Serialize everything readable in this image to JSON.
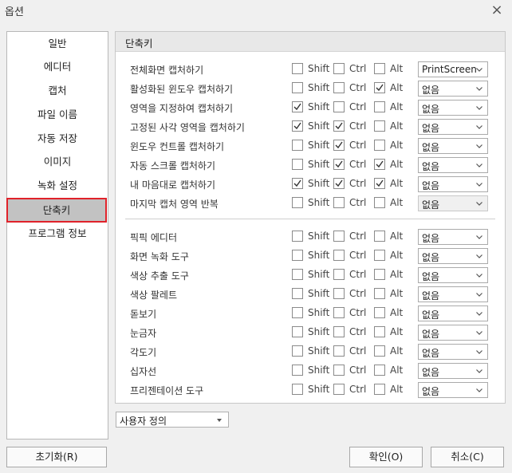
{
  "window": {
    "title": "옵션"
  },
  "sidebar": {
    "items": [
      {
        "label": "일반"
      },
      {
        "label": "에디터"
      },
      {
        "label": "캡처"
      },
      {
        "label": "파일 이름"
      },
      {
        "label": "자동 저장"
      },
      {
        "label": "이미지"
      },
      {
        "label": "녹화 설정"
      },
      {
        "label": "단축키",
        "selected": true
      },
      {
        "label": "프로그램 정보"
      }
    ]
  },
  "panel": {
    "title": "단축키",
    "modifier_labels": {
      "shift": "Shift",
      "ctrl": "Ctrl",
      "alt": "Alt"
    },
    "rows": [
      {
        "label": "전체화면 캡처하기",
        "shift": false,
        "ctrl": false,
        "alt": false,
        "key": "PrintScreen",
        "key_disabled": false
      },
      {
        "label": "활성화된 윈도우 캡처하기",
        "shift": false,
        "ctrl": false,
        "alt": true,
        "key": "없음",
        "key_disabled": false
      },
      {
        "label": "영역을 지정하여 캡처하기",
        "shift": true,
        "ctrl": false,
        "alt": false,
        "key": "없음",
        "key_disabled": false
      },
      {
        "label": "고정된 사각 영역을 캡처하기",
        "shift": true,
        "ctrl": true,
        "alt": false,
        "key": "없음",
        "key_disabled": false
      },
      {
        "label": "윈도우 컨트롤 캡처하기",
        "shift": false,
        "ctrl": true,
        "alt": false,
        "key": "없음",
        "key_disabled": false
      },
      {
        "label": "자동 스크롤 캡처하기",
        "shift": false,
        "ctrl": true,
        "alt": true,
        "key": "없음",
        "key_disabled": false
      },
      {
        "label": "내 마음대로 캡처하기",
        "shift": true,
        "ctrl": true,
        "alt": true,
        "key": "없음",
        "key_disabled": false
      },
      {
        "label": "마지막 캡처 영역 반복",
        "shift": false,
        "ctrl": false,
        "alt": false,
        "key": "없음",
        "key_disabled": true
      },
      {
        "label": "픽픽 에디터",
        "shift": false,
        "ctrl": false,
        "alt": false,
        "key": "없음",
        "key_disabled": false
      },
      {
        "label": "화면 녹화 도구",
        "shift": false,
        "ctrl": false,
        "alt": false,
        "key": "없음",
        "key_disabled": false
      },
      {
        "label": "색상 추출 도구",
        "shift": false,
        "ctrl": false,
        "alt": false,
        "key": "없음",
        "key_disabled": false
      },
      {
        "label": "색상 팔레트",
        "shift": false,
        "ctrl": false,
        "alt": false,
        "key": "없음",
        "key_disabled": false
      },
      {
        "label": "돋보기",
        "shift": false,
        "ctrl": false,
        "alt": false,
        "key": "없음",
        "key_disabled": false
      },
      {
        "label": "눈금자",
        "shift": false,
        "ctrl": false,
        "alt": false,
        "key": "없음",
        "key_disabled": false
      },
      {
        "label": "각도기",
        "shift": false,
        "ctrl": false,
        "alt": false,
        "key": "없음",
        "key_disabled": false
      },
      {
        "label": "십자선",
        "shift": false,
        "ctrl": false,
        "alt": false,
        "key": "없음",
        "key_disabled": false
      },
      {
        "label": "프리젠테이션 도구",
        "shift": false,
        "ctrl": false,
        "alt": false,
        "key": "없음",
        "key_disabled": false
      }
    ]
  },
  "preset": {
    "value": "사용자 정의"
  },
  "buttons": {
    "reset": "초기화(R)",
    "ok": "확인(O)",
    "cancel": "취소(C)"
  },
  "colors": {
    "selection_outline": "#e0222a",
    "selection_bg": "#c2c2c2"
  }
}
